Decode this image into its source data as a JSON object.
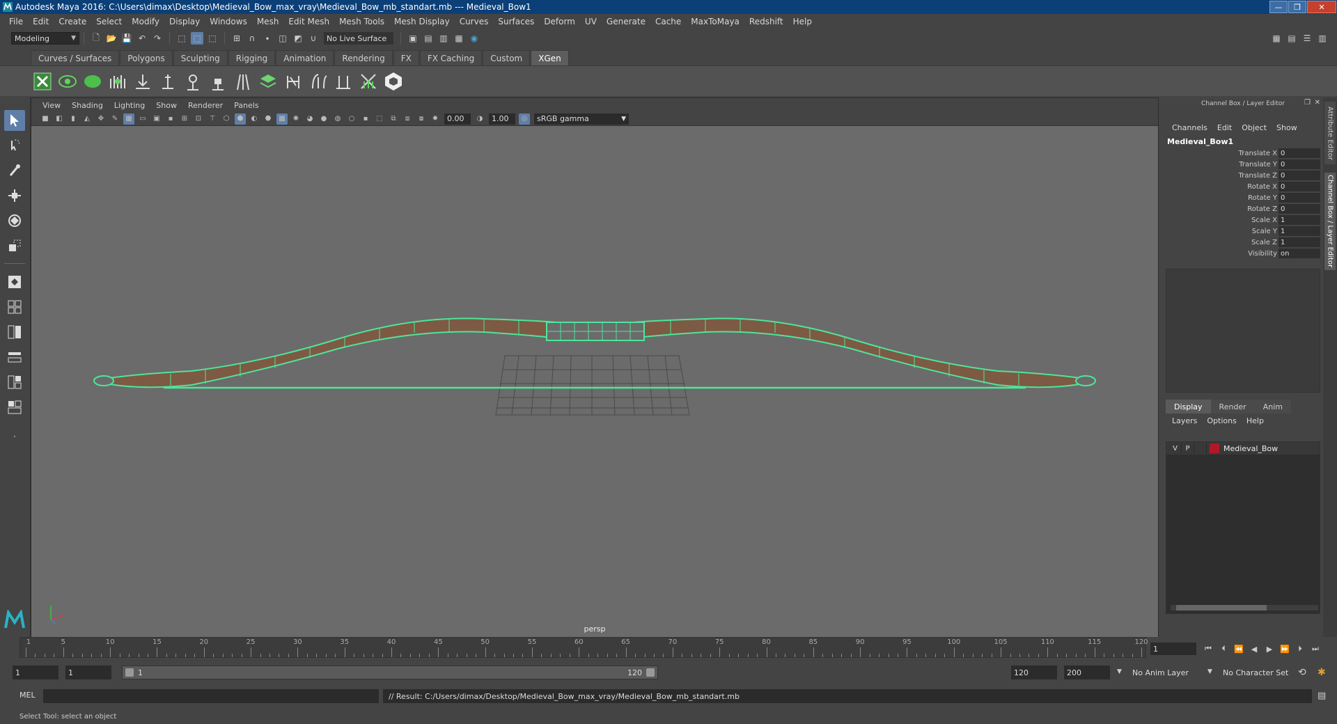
{
  "window": {
    "title": "Autodesk Maya 2016: C:\\Users\\dimax\\Desktop\\Medieval_Bow_max_vray\\Medieval_Bow_mb_standart.mb   ---   Medieval_Bow1",
    "minimize_glyph": "—",
    "maximize_glyph": "❐",
    "close_glyph": "✕"
  },
  "menubar": [
    "File",
    "Edit",
    "Create",
    "Select",
    "Modify",
    "Display",
    "Windows",
    "Mesh",
    "Edit Mesh",
    "Mesh Tools",
    "Mesh Display",
    "Curves",
    "Surfaces",
    "Deform",
    "UV",
    "Generate",
    "Cache",
    "MaxToMaya",
    "Redshift",
    "Help"
  ],
  "statusline": {
    "mode": "Modeling",
    "live_surface": "No Live Surface"
  },
  "shelf": {
    "tabs": [
      "Curves / Surfaces",
      "Polygons",
      "Sculpting",
      "Rigging",
      "Animation",
      "Rendering",
      "FX",
      "FX Caching",
      "Custom",
      "XGen"
    ],
    "active_tab": "XGen"
  },
  "panel": {
    "menus": [
      "View",
      "Shading",
      "Lighting",
      "Show",
      "Renderer",
      "Panels"
    ],
    "exposure": "0.00",
    "gamma": "1.00",
    "color_space": "sRGB gamma",
    "camera": "persp"
  },
  "channel_box": {
    "header": "Channel Box / Layer Editor",
    "menus": [
      "Channels",
      "Edit",
      "Object",
      "Show"
    ],
    "object_name": "Medieval_Bow1",
    "attributes": [
      {
        "label": "Translate X",
        "value": "0"
      },
      {
        "label": "Translate Y",
        "value": "0"
      },
      {
        "label": "Translate Z",
        "value": "0"
      },
      {
        "label": "Rotate X",
        "value": "0"
      },
      {
        "label": "Rotate Y",
        "value": "0"
      },
      {
        "label": "Rotate Z",
        "value": "0"
      },
      {
        "label": "Scale X",
        "value": "1"
      },
      {
        "label": "Scale Y",
        "value": "1"
      },
      {
        "label": "Scale Z",
        "value": "1"
      },
      {
        "label": "Visibility",
        "value": "on"
      }
    ]
  },
  "layer_editor": {
    "tabs": [
      "Display",
      "Render",
      "Anim"
    ],
    "active_tab": "Display",
    "menus": [
      "Layers",
      "Options",
      "Help"
    ],
    "layers": [
      {
        "v": "V",
        "p": "P",
        "name": "Medieval_Bow",
        "color": "#b0182a"
      }
    ]
  },
  "side_tabs": [
    "Attribute Editor",
    "Channel Box / Layer Editor"
  ],
  "timeline": {
    "ticks": [
      1,
      5,
      10,
      15,
      20,
      25,
      30,
      35,
      40,
      45,
      50,
      55,
      60,
      65,
      70,
      75,
      80,
      85,
      90,
      95,
      100,
      105,
      110,
      115,
      120
    ],
    "start": 1,
    "end": 120,
    "current_frame": "1"
  },
  "range": {
    "start_field": "1",
    "playback_start": "1",
    "slider_start": "1",
    "slider_end": "120",
    "playback_end": "120",
    "end_field": "200",
    "anim_layer": "No Anim Layer",
    "character_set": "No Character Set"
  },
  "command": {
    "mel_label": "MEL",
    "result": "// Result: C:/Users/dimax/Desktop/Medieval_Bow_max_vray/Medieval_Bow_mb_standart.mb"
  },
  "help_line": "Select Tool: select an object",
  "colors": {
    "wireframe": "#4de69a",
    "bow_wood": "#7d5a44",
    "selection": "#5f7fa8",
    "title_bar": "#0b3f78"
  }
}
